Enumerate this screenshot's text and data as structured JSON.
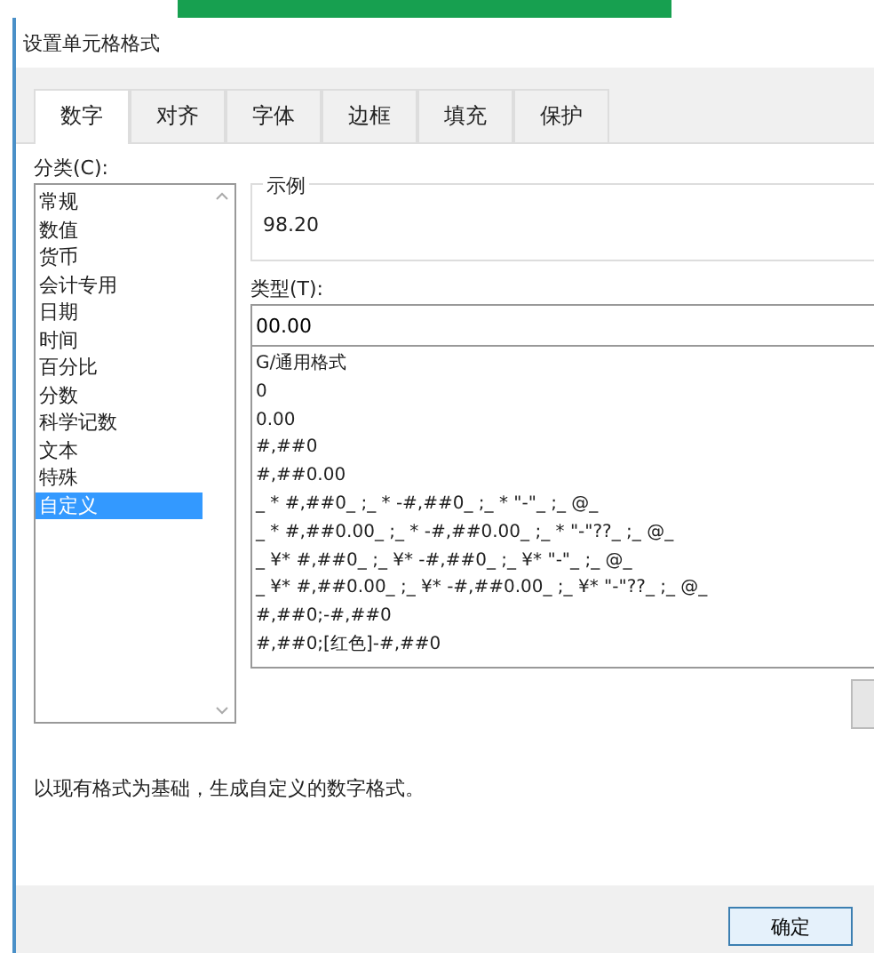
{
  "window": {
    "title": "设置单元格格式"
  },
  "tabs": [
    {
      "label": "数字",
      "selected": true
    },
    {
      "label": "对齐",
      "selected": false
    },
    {
      "label": "字体",
      "selected": false
    },
    {
      "label": "边框",
      "selected": false
    },
    {
      "label": "填充",
      "selected": false
    },
    {
      "label": "保护",
      "selected": false
    }
  ],
  "category": {
    "label": "分类(C):",
    "items": [
      {
        "label": "常规",
        "selected": false
      },
      {
        "label": "数值",
        "selected": false
      },
      {
        "label": "货币",
        "selected": false
      },
      {
        "label": "会计专用",
        "selected": false
      },
      {
        "label": "日期",
        "selected": false
      },
      {
        "label": "时间",
        "selected": false
      },
      {
        "label": "百分比",
        "selected": false
      },
      {
        "label": "分数",
        "selected": false
      },
      {
        "label": "科学记数",
        "selected": false
      },
      {
        "label": "文本",
        "selected": false
      },
      {
        "label": "特殊",
        "selected": false
      },
      {
        "label": "自定义",
        "selected": true
      }
    ]
  },
  "sample": {
    "label": "示例",
    "value": "98.20"
  },
  "type": {
    "label": "类型(T):",
    "value": "00.00",
    "formats": [
      "G/通用格式",
      "0",
      "0.00",
      "#,##0",
      "#,##0.00",
      "_ * #,##0_ ;_ * -#,##0_ ;_ * \"-\"_ ;_ @_",
      "_ * #,##0.00_ ;_ * -#,##0.00_ ;_ * \"-\"??_ ;_ @_",
      "_ ¥* #,##0_ ;_ ¥* -#,##0_ ;_ ¥* \"-\"_ ;_ @_",
      "_ ¥* #,##0.00_ ;_ ¥* -#,##0.00_ ;_ ¥* \"-\"??_ ;_ @_",
      "#,##0;-#,##0",
      "#,##0;[红色]-#,##0"
    ]
  },
  "description": "以现有格式为基础，生成自定义的数字格式。",
  "buttons": [
    "确定"
  ]
}
